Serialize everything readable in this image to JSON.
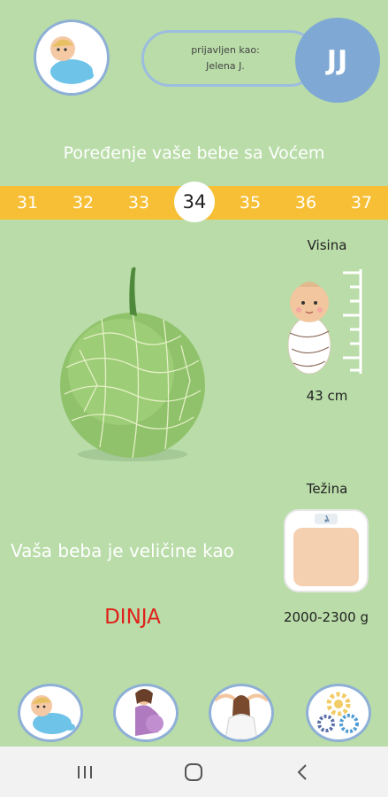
{
  "header": {
    "logged_in_label": "prijavljen kao:",
    "user_name": "Jelena J.",
    "avatar_initials": "JJ"
  },
  "page_title": "Poređenje vaše bebe sa Voćem",
  "weeks": [
    "31",
    "32",
    "33",
    "34",
    "35",
    "36",
    "37"
  ],
  "current_week": "34",
  "height": {
    "label": "Visina",
    "value": "43 cm"
  },
  "weight": {
    "label": "Težina",
    "value": "2000-2300 g"
  },
  "size_text": "Vaša beba je veličine kao",
  "fruit_name": "DINJA",
  "colors": {
    "background": "#b9dca8",
    "week_strip": "#f7bf35",
    "fruit_name": "#e0201a",
    "avatar": "#7fa9d4"
  },
  "bottom_nav": [
    {
      "icon": "baby-icon"
    },
    {
      "icon": "pregnant-woman-icon"
    },
    {
      "icon": "mother-relax-icon"
    },
    {
      "icon": "settings-gears-icon"
    }
  ],
  "system_nav": [
    "recent-apps-icon",
    "home-icon",
    "back-icon"
  ]
}
